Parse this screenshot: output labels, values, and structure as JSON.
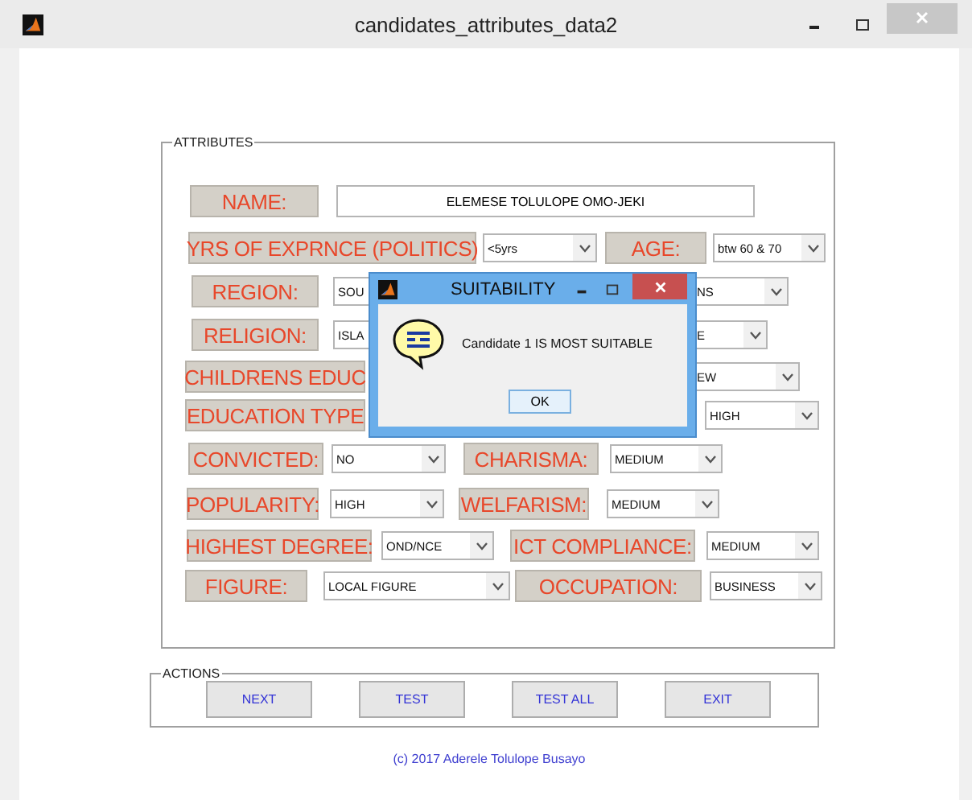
{
  "window": {
    "title": "candidates_attributes_data2"
  },
  "attributes": {
    "title": "ATTRIBUTES",
    "rows": [
      [
        {
          "kind": "label",
          "text": "NAME:"
        },
        {
          "kind": "text",
          "value": "ELEMESE TOLULOPE OMO-JEKI"
        }
      ],
      [
        {
          "kind": "label",
          "text": "YRS OF EXPRNCE (POLITICS)"
        },
        {
          "kind": "combo",
          "value": "<5yrs"
        },
        {
          "kind": "label",
          "text": "AGE:"
        },
        {
          "kind": "combo",
          "value": "btw 60 & 70"
        }
      ],
      [
        {
          "kind": "label",
          "text": "REGION:"
        },
        {
          "kind": "combo",
          "value": "SOU"
        },
        {
          "kind": "combo",
          "value": "NS"
        }
      ],
      [
        {
          "kind": "label",
          "text": "RELIGION:"
        },
        {
          "kind": "combo",
          "value": "ISLA"
        },
        {
          "kind": "combo",
          "value": "E"
        }
      ],
      [
        {
          "kind": "label",
          "text": "CHILDRENS EDUC"
        },
        {
          "kind": "combo",
          "value": "EW"
        }
      ],
      [
        {
          "kind": "label",
          "text": "EDUCATION TYPE"
        },
        {
          "kind": "combo",
          "value": "HIGH"
        }
      ],
      [
        {
          "kind": "label",
          "text": "CONVICTED:"
        },
        {
          "kind": "combo",
          "value": "NO"
        },
        {
          "kind": "label",
          "text": "CHARISMA:"
        },
        {
          "kind": "combo",
          "value": "MEDIUM"
        }
      ],
      [
        {
          "kind": "label",
          "text": "POPULARITY:"
        },
        {
          "kind": "combo",
          "value": "HIGH"
        },
        {
          "kind": "label",
          "text": "WELFARISM:"
        },
        {
          "kind": "combo",
          "value": "MEDIUM"
        }
      ],
      [
        {
          "kind": "label",
          "text": "HIGHEST DEGREE:"
        },
        {
          "kind": "combo",
          "value": "OND/NCE"
        },
        {
          "kind": "label",
          "text": "ICT COMPLIANCE:"
        },
        {
          "kind": "combo",
          "value": "MEDIUM"
        }
      ],
      [
        {
          "kind": "label",
          "text": "FIGURE:"
        },
        {
          "kind": "combo",
          "value": "LOCAL FIGURE"
        },
        {
          "kind": "label",
          "text": "OCCUPATION:"
        },
        {
          "kind": "combo",
          "value": "BUSINESS"
        }
      ]
    ]
  },
  "actions": {
    "title": "ACTIONS",
    "buttons": [
      "NEXT",
      "TEST",
      "TEST ALL",
      "EXIT"
    ]
  },
  "footer": "(c) 2017 Aderele Tolulope Busayo",
  "dialog": {
    "title": "SUITABILITY",
    "message": "Candidate 1 IS MOST SUITABLE",
    "button": "OK"
  }
}
